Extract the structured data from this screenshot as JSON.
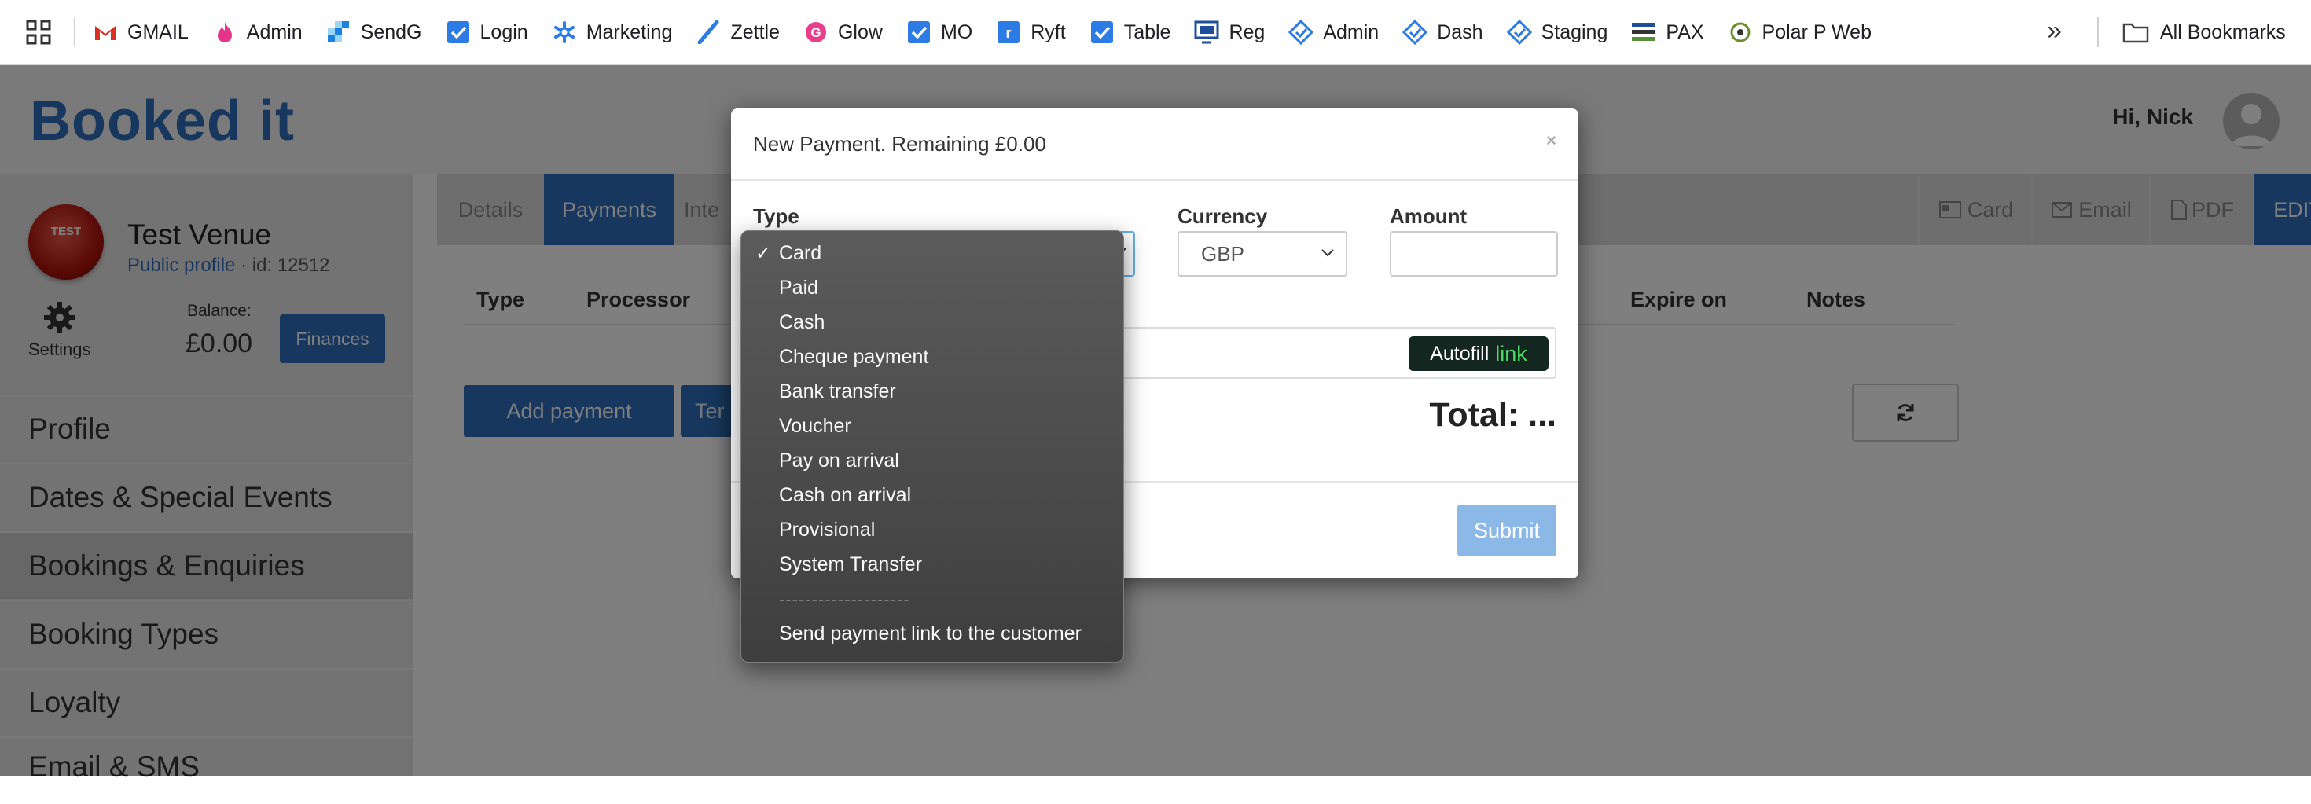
{
  "bookmarks": {
    "items": [
      {
        "label": "GMAIL",
        "icon": "gmail-icon",
        "color": "#d93025"
      },
      {
        "label": "Admin",
        "icon": "flame-icon",
        "color": "#e8338a"
      },
      {
        "label": "SendG",
        "icon": "sendgrid-icon",
        "color": "#1a82e2"
      },
      {
        "label": "Login",
        "icon": "checkbox-icon",
        "color": "#2d7be5"
      },
      {
        "label": "Marketing",
        "icon": "asterisk-icon",
        "color": "#2d7be5"
      },
      {
        "label": "Zettle",
        "icon": "slash-icon",
        "color": "#2d7be5"
      },
      {
        "label": "Glow",
        "icon": "glow-icon",
        "color": "#e83e8c"
      },
      {
        "label": "MO",
        "icon": "checkbox-icon",
        "color": "#2d7be5"
      },
      {
        "label": "Ryft",
        "icon": "ryft-icon",
        "color": "#2d7be5"
      },
      {
        "label": "Table",
        "icon": "checkbox-icon",
        "color": "#2d7be5"
      },
      {
        "label": "Reg",
        "icon": "monitor-icon",
        "color": "#1f4e9a"
      },
      {
        "label": "Admin",
        "icon": "diamond-check-icon",
        "color": "#2d7be5"
      },
      {
        "label": "Dash",
        "icon": "diamond-check-icon",
        "color": "#2d7be5"
      },
      {
        "label": "Staging",
        "icon": "diamond-check-icon",
        "color": "#2d7be5"
      },
      {
        "label": "PAX",
        "icon": "lines-icon",
        "color": "#5a8f3a"
      },
      {
        "label": "Polar P Web",
        "icon": "polar-icon",
        "color": "#6a8f2a"
      }
    ],
    "all_bookmarks": "All Bookmarks"
  },
  "header": {
    "logo": "Booked it",
    "greeting": "Hi, Nick"
  },
  "sidebar": {
    "venue_name": "Test Venue",
    "venue_logo_text": "TEST",
    "public_profile": "Public profile",
    "venue_id": " · id: 12512",
    "settings_label": "Settings",
    "balance_label": "Balance:",
    "balance_value": "£0.00",
    "finances_button": "Finances",
    "nav": [
      {
        "label": "Profile"
      },
      {
        "label": "Dates & Special Events"
      },
      {
        "label": "Bookings & Enquiries"
      },
      {
        "label": "Booking Types"
      },
      {
        "label": "Loyalty"
      },
      {
        "label": "Email & SMS"
      }
    ]
  },
  "main": {
    "tabs": [
      "Details",
      "Payments",
      "Inte"
    ],
    "right_tabs": {
      "card": "Card",
      "email": "Email",
      "pdf": "PDF",
      "edit": "EDIT"
    },
    "columns": [
      "Type",
      "Processor",
      "Expire on",
      "Notes"
    ],
    "add_payment": "Add payment",
    "term_button": "Ter"
  },
  "modal": {
    "title": "New Payment. Remaining £0.00",
    "close": "×",
    "type_label": "Type",
    "currency_label": "Currency",
    "currency_value": "GBP",
    "amount_label": "Amount",
    "autofill": "Autofill",
    "autofill_link": "link",
    "total": "Total: ...",
    "submit": "Submit"
  },
  "type_dropdown": {
    "selected": "Card",
    "options": [
      "Card",
      "Paid",
      "Cash",
      "Cheque payment",
      "Bank transfer",
      "Voucher",
      "Pay on arrival",
      "Cash on arrival",
      "Provisional",
      "System Transfer"
    ],
    "separator": "--------------------",
    "extra_option": "Send payment link to the customer"
  }
}
